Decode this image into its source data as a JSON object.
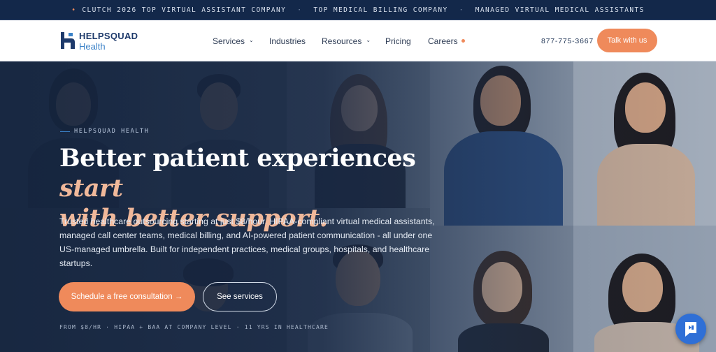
{
  "announcement": {
    "items": [
      "CLUTCH 2026 TOP VIRTUAL ASSISTANT COMPANY",
      "TOP MEDICAL BILLING COMPANY",
      "MANAGED VIRTUAL MEDICAL ASSISTANTS"
    ],
    "separator": "·",
    "bullet": "•"
  },
  "header": {
    "logo": {
      "line1": "HELPSQUAD",
      "line2": "Health",
      "icon": "helpsquad-logo-icon"
    },
    "nav": [
      {
        "label": "Services",
        "has_dropdown": true
      },
      {
        "label": "Industries",
        "has_dropdown": false
      },
      {
        "label": "Resources",
        "has_dropdown": true
      },
      {
        "label": "Pricing",
        "has_dropdown": false
      },
      {
        "label": "Careers",
        "has_dropdown": false,
        "has_indicator_dot": true
      }
    ],
    "dropdown_glyph": "⌄",
    "phone": "877-775-3667",
    "cta_label": "Talk with us"
  },
  "hero": {
    "eyebrow": "HELPSQUAD HEALTH",
    "headline": {
      "part1": "Better patient experiences ",
      "accent1": "start",
      "accent2": "with better support."
    },
    "lede": "Trusted healthcare outsourcing starting at just $8/hour. HIPAA-compliant virtual medical assistants, managed call center teams, medical billing, and AI-powered patient communication - all under one US-managed umbrella. Built for independent practices, medical groups, hospitals, and healthcare startups.",
    "primary_cta": "Schedule a free consultation →",
    "secondary_cta": "See services",
    "facts": "FROM $8/HR · HIPAA + BAA AT COMPANY LEVEL · 11 YRS IN HEALTHCARE"
  },
  "chat_widget": {
    "icon": "chat-launcher-icon"
  },
  "colors": {
    "navy": "#13284a",
    "accent_orange": "#ef8a5b",
    "brand_blue": "#3b82c8",
    "headline_accent": "#f0b89a"
  }
}
